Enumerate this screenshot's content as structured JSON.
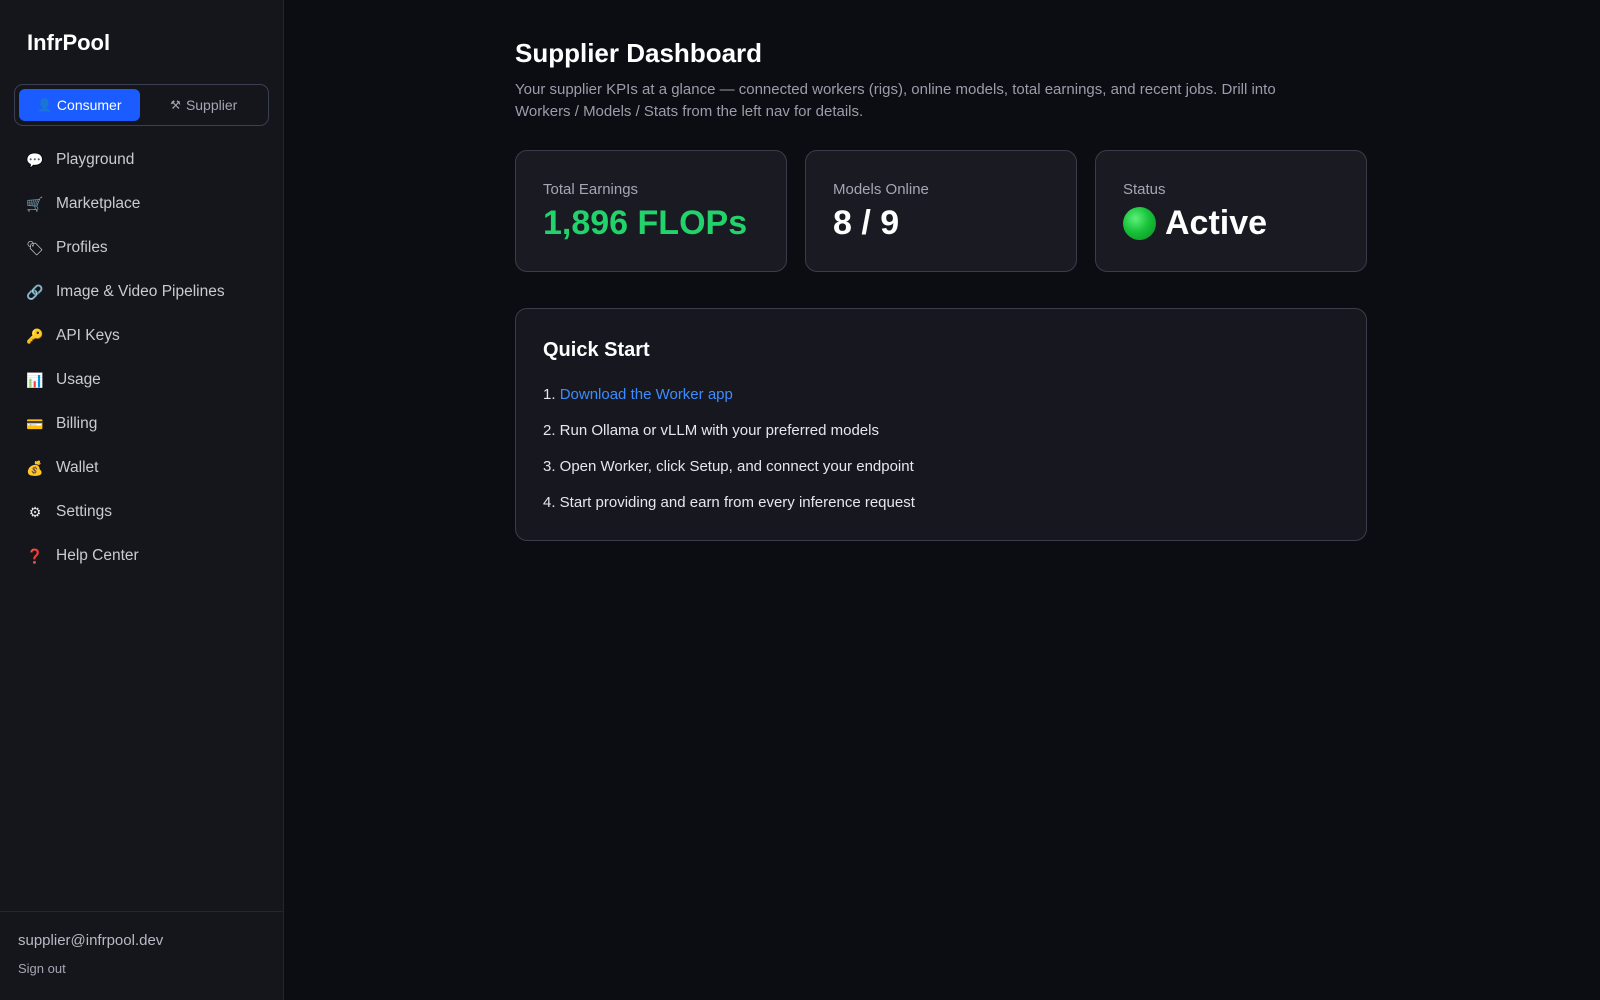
{
  "brand": "InfrPool",
  "mode_toggle": {
    "consumer": {
      "icon": "👤",
      "label": "Consumer",
      "active": true
    },
    "supplier": {
      "icon": "⚒",
      "label": "Supplier",
      "active": false
    }
  },
  "nav": [
    {
      "icon": "💬",
      "icon_name": "chat-bubble-icon",
      "label": "Playground"
    },
    {
      "icon": "🛒",
      "icon_name": "cart-icon",
      "label": "Marketplace"
    },
    {
      "icon": "🏷",
      "icon_name": "tag-icon",
      "label": "Profiles"
    },
    {
      "icon": "🔗",
      "icon_name": "link-icon",
      "label": "Image & Video Pipelines"
    },
    {
      "icon": "🔑",
      "icon_name": "key-icon",
      "label": "API Keys"
    },
    {
      "icon": "📊",
      "icon_name": "bar-chart-icon",
      "label": "Usage"
    },
    {
      "icon": "💳",
      "icon_name": "credit-card-icon",
      "label": "Billing"
    },
    {
      "icon": "💰",
      "icon_name": "money-bag-icon",
      "label": "Wallet"
    },
    {
      "icon": "⚙",
      "icon_name": "gear-icon",
      "label": "Settings"
    },
    {
      "icon": "❓",
      "icon_name": "question-icon",
      "label": "Help Center"
    }
  ],
  "user": {
    "email": "supplier@infrpool.dev",
    "sign_out": "Sign out"
  },
  "page": {
    "title": "Supplier Dashboard",
    "subtitle": "Your supplier KPIs at a glance — connected workers (rigs), online models, total earnings, and recent jobs. Drill into Workers / Models / Stats from the left nav for details."
  },
  "kpis": {
    "earnings": {
      "label": "Total Earnings",
      "value": "1,896 FLOPs"
    },
    "models": {
      "label": "Models Online",
      "value": "8 / 9"
    },
    "status": {
      "label": "Status",
      "value": "Active"
    }
  },
  "quickstart": {
    "title": "Quick Start",
    "step1_prefix": "1. ",
    "step1_link": "Download the Worker app",
    "step2": "2. Run Ollama or vLLM with your preferred models",
    "step3": "3. Open Worker, click Setup, and connect your endpoint",
    "step4": "4. Start providing and earn from every inference request"
  },
  "colors": {
    "accent": "#1a5cff",
    "earnings_green": "#22d36b",
    "link_blue": "#3b8cff",
    "status_active": "#18c33a"
  }
}
